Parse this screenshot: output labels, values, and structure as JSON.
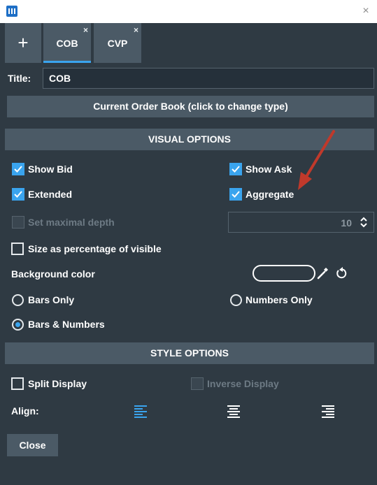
{
  "window": {
    "close_glyph": "×"
  },
  "tabs": {
    "add_glyph": "+",
    "items": [
      {
        "label": "COB",
        "close": "×"
      },
      {
        "label": "CVP",
        "close": "×"
      }
    ]
  },
  "title_field": {
    "label": "Title:",
    "value": "COB"
  },
  "type_button": "Current Order Book (click to change type)",
  "visual": {
    "header": "VISUAL OPTIONS",
    "show_bid": "Show Bid",
    "show_ask": "Show Ask",
    "extended": "Extended",
    "aggregate": "Aggregate",
    "set_max_depth": "Set maximal depth",
    "depth_value": "10",
    "size_pct": "Size as percentage of visible",
    "background_color": "Background color",
    "bars_only": "Bars Only",
    "numbers_only": "Numbers Only",
    "bars_numbers": "Bars & Numbers",
    "selected_mode": "Bars & Numbers"
  },
  "style": {
    "header": "STYLE OPTIONS",
    "split_display": "Split Display",
    "inverse_display": "Inverse Display",
    "align_label": "Align:",
    "selected_align": "left"
  },
  "close_button": "Close",
  "colors": {
    "accent": "#3aa4ee",
    "panel": "#2f3a43",
    "button": "#4b5a66",
    "annotation_arrow": "#c0392b"
  },
  "icons": [
    "app-icon",
    "close-icon",
    "plus-icon",
    "checkbox-icon",
    "eyedropper-icon",
    "reset-icon",
    "align-left-icon",
    "align-center-icon",
    "align-right-icon",
    "spinner-arrows-icon"
  ]
}
